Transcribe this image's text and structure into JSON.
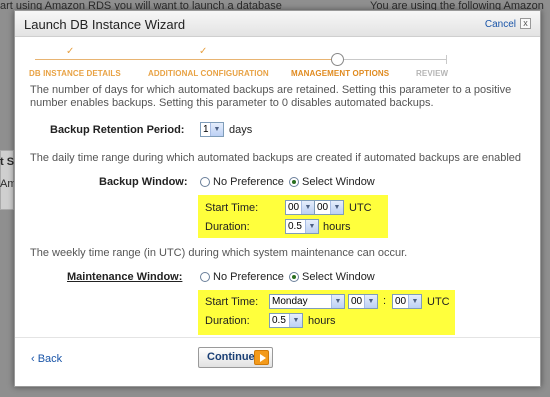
{
  "background": {
    "top_left_text": "art using Amazon RDS you will want to launch a database",
    "top_right_text": "You are using the following Amazon",
    "left_fragment_1": "t S",
    "left_fragment_2": "Am"
  },
  "wizard": {
    "title": "Launch DB Instance Wizard",
    "cancel_label": "Cancel",
    "close_glyph": "x",
    "steps": [
      {
        "label": "DB INSTANCE DETAILS",
        "status": "done"
      },
      {
        "label": "ADDITIONAL CONFIGURATION",
        "status": "done"
      },
      {
        "label": "MANAGEMENT OPTIONS",
        "status": "active"
      },
      {
        "label": "REVIEW",
        "status": "todo"
      }
    ],
    "check_glyph": "✓",
    "retention": {
      "description": "The number of days for which automated backups are retained. Setting this parameter to a positive number enables backups. Setting this parameter to 0 disables automated backups.",
      "label": "Backup Retention Period:",
      "value": "1",
      "unit": "days"
    },
    "backup_window": {
      "description": "The daily time range during which automated backups are created if automated backups are enabled",
      "label": "Backup Window:",
      "option_no_pref": "No Preference",
      "option_select": "Select Window",
      "selected": "Select Window",
      "start_time_label": "Start Time:",
      "start_hour": "00",
      "start_minute": "00",
      "time_sep": ":",
      "tz": "UTC",
      "duration_label": "Duration:",
      "duration_value": "0.5",
      "duration_unit": "hours"
    },
    "maintenance_window": {
      "description": "The weekly time range (in UTC) during which system maintenance can occur.",
      "label": "Maintenance Window:",
      "option_no_pref": "No Preference",
      "option_select": "Select Window",
      "selected": "Select Window",
      "start_time_label": "Start Time:",
      "day": "Monday",
      "start_hour": "00",
      "start_minute": "00",
      "time_sep": ":",
      "tz": "UTC",
      "duration_label": "Duration:",
      "duration_value": "0.5",
      "duration_unit": "hours"
    },
    "back_label": "‹ Back",
    "continue_label": "Continue"
  },
  "colors": {
    "highlight": "#ffff3c",
    "step_done": "#e8a244",
    "step_active": "#e08a1e",
    "link": "#1a55a8",
    "continue_arrow": "#f39a1b"
  }
}
